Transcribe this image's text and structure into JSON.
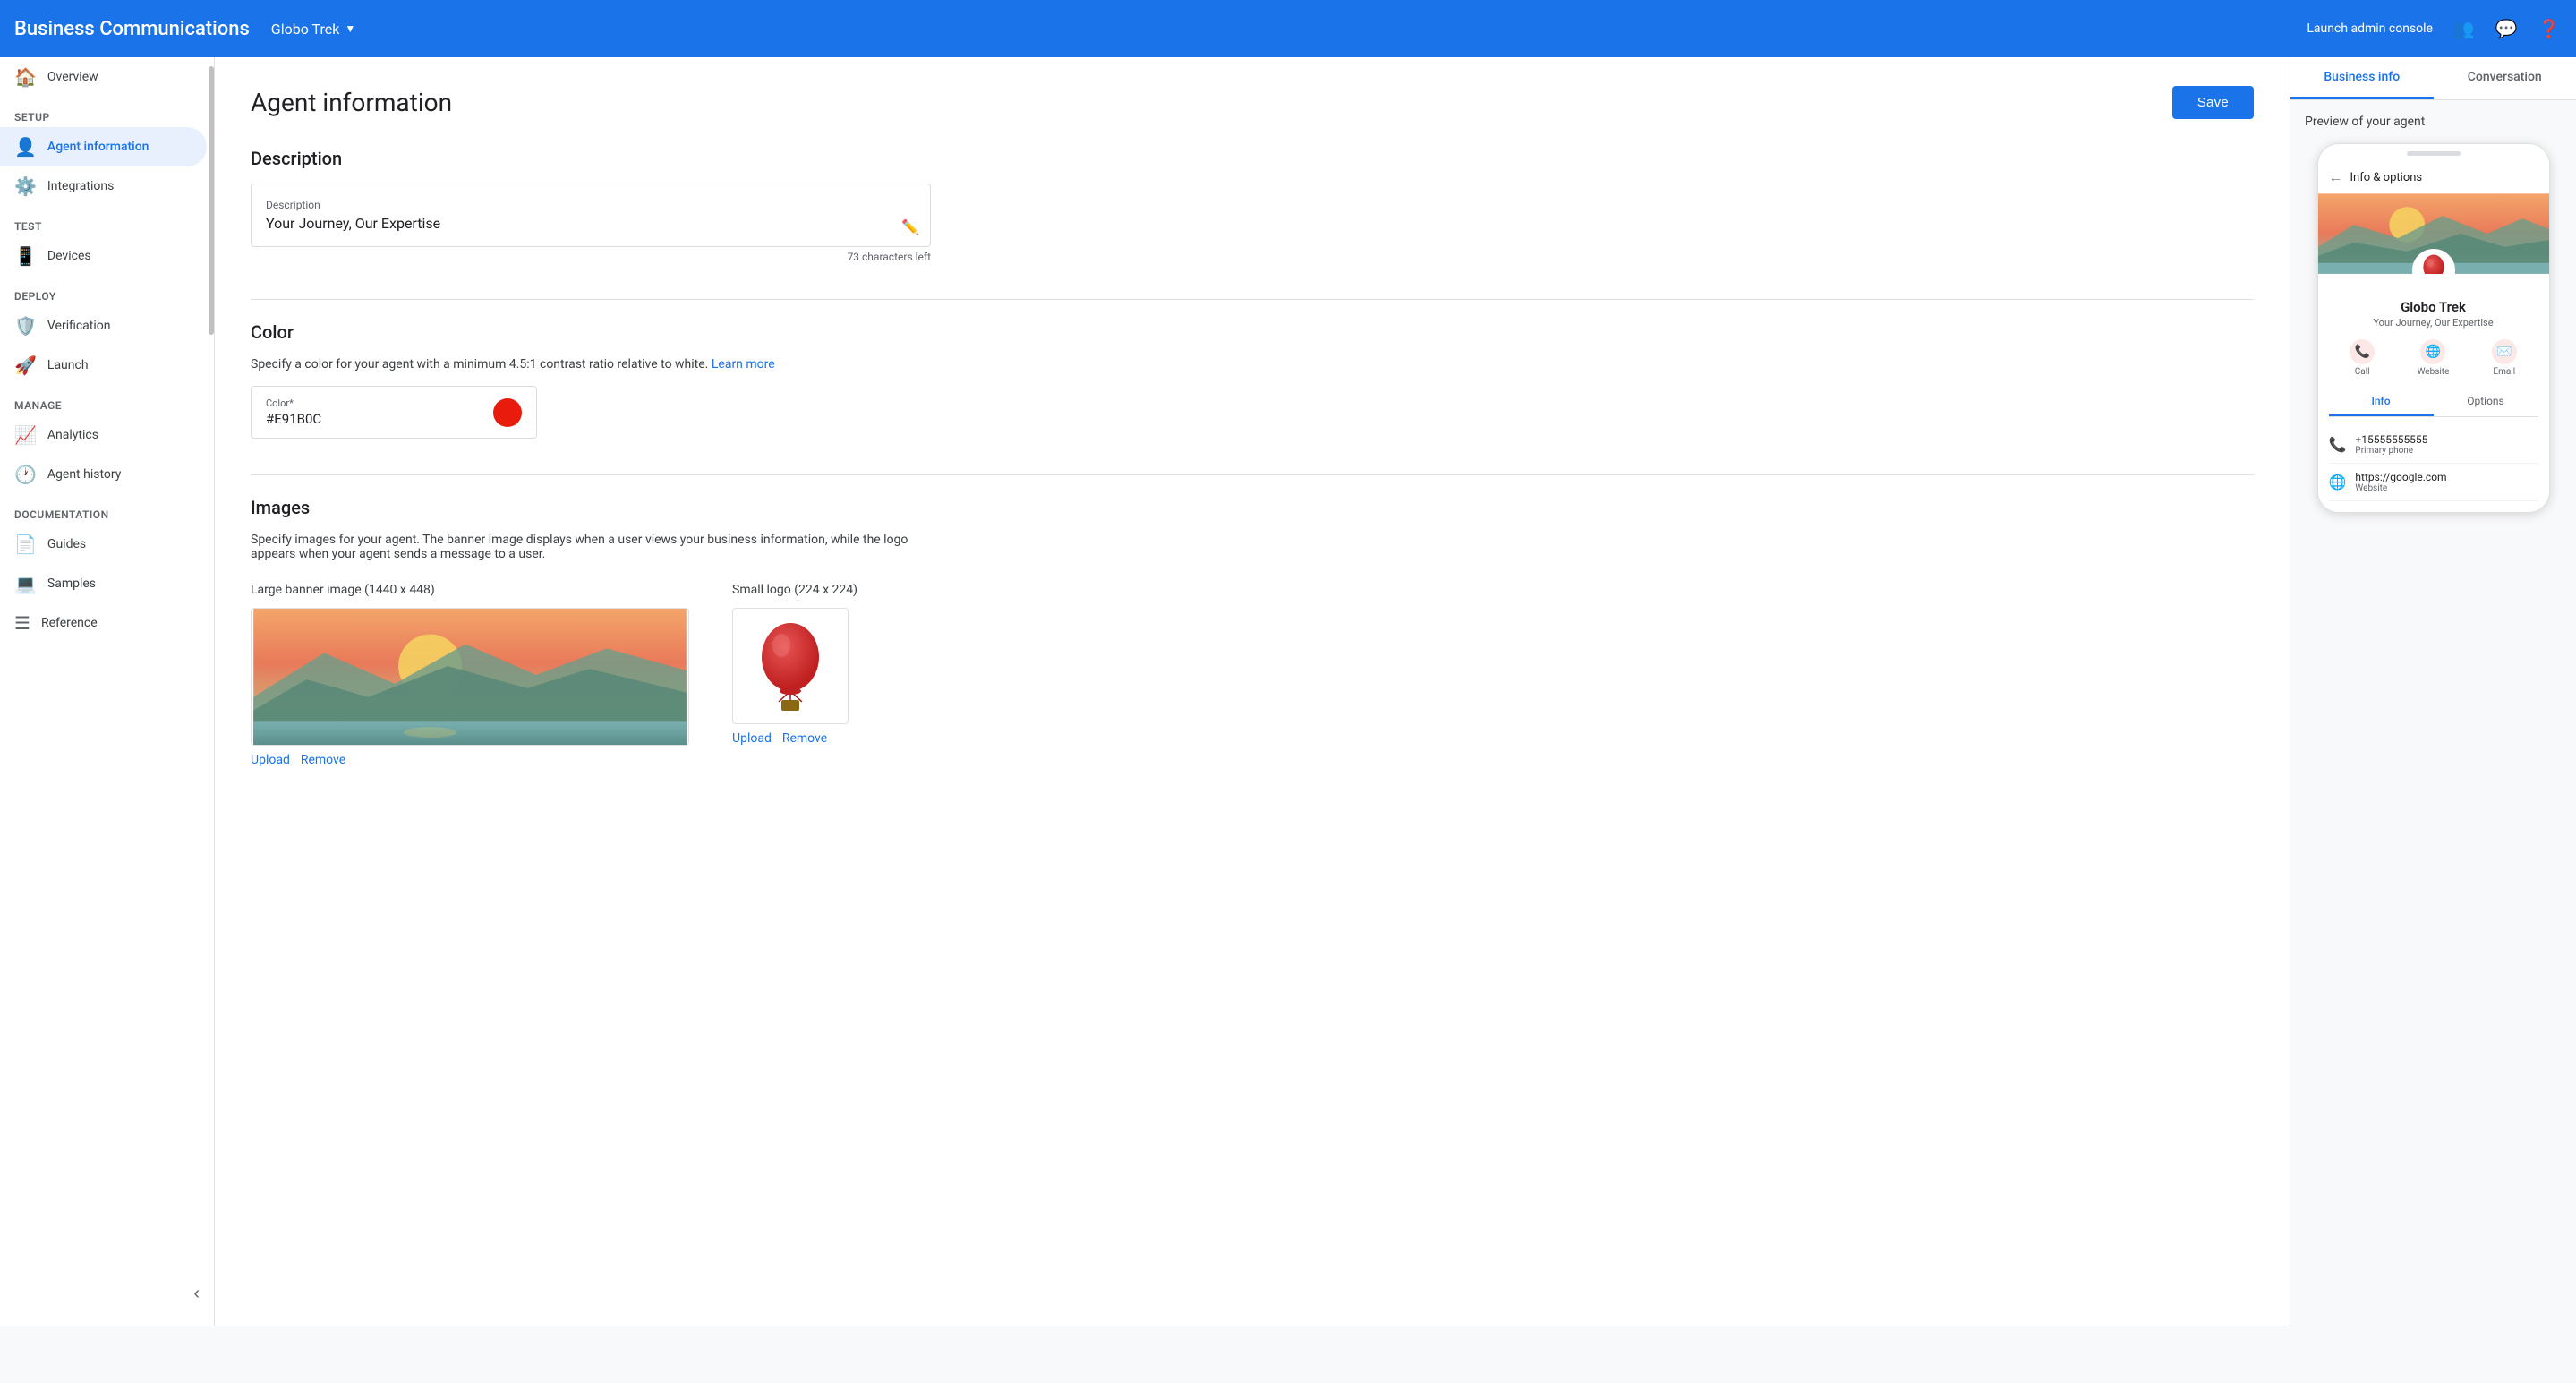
{
  "app": {
    "title": "Business Communications",
    "brand": "Globo Trek",
    "launch_admin_console": "Launch admin console"
  },
  "sidebar": {
    "sections": [
      {
        "label": "",
        "items": [
          {
            "id": "overview",
            "label": "Overview",
            "icon": "🏠",
            "active": false
          }
        ]
      },
      {
        "label": "Setup",
        "items": [
          {
            "id": "agent-information",
            "label": "Agent information",
            "icon": "👤",
            "active": true
          },
          {
            "id": "integrations",
            "label": "Integrations",
            "icon": "🔗",
            "active": false
          }
        ]
      },
      {
        "label": "Test",
        "items": [
          {
            "id": "devices",
            "label": "Devices",
            "icon": "📱",
            "active": false
          }
        ]
      },
      {
        "label": "Deploy",
        "items": [
          {
            "id": "verification",
            "label": "Verification",
            "icon": "🛡️",
            "active": false
          },
          {
            "id": "launch",
            "label": "Launch",
            "icon": "🚀",
            "active": false
          }
        ]
      },
      {
        "label": "Manage",
        "items": [
          {
            "id": "analytics",
            "label": "Analytics",
            "icon": "📈",
            "active": false
          },
          {
            "id": "agent-history",
            "label": "Agent history",
            "icon": "🕐",
            "active": false
          }
        ]
      },
      {
        "label": "Documentation",
        "items": [
          {
            "id": "guides",
            "label": "Guides",
            "icon": "📄",
            "active": false
          },
          {
            "id": "samples",
            "label": "Samples",
            "icon": "💻",
            "active": false
          },
          {
            "id": "reference",
            "label": "Reference",
            "icon": "☰",
            "active": false
          }
        ]
      }
    ]
  },
  "main": {
    "page_title": "Agent information",
    "save_button": "Save",
    "sections": {
      "description": {
        "title": "Description",
        "field_label": "Description",
        "field_value": "Your Journey, Our Expertise",
        "char_count": "73 characters left"
      },
      "color": {
        "title": "Color",
        "description": "Specify a color for your agent with a minimum 4.5:1 contrast ratio relative to white.",
        "learn_more": "Learn more",
        "field_label": "Color*",
        "field_value": "#E91B0C",
        "color_hex": "#E91B0C"
      },
      "images": {
        "title": "Images",
        "description": "Specify images for your agent. The banner image displays when a user views your business information, while the logo appears when your agent sends a message to a user.",
        "banner_label": "Large banner image (1440 x 448)",
        "logo_label": "Small logo (224 x 224)",
        "upload_label": "Upload",
        "remove_label": "Remove"
      }
    }
  },
  "preview": {
    "tabs": [
      {
        "id": "business-info",
        "label": "Business info",
        "active": true
      },
      {
        "id": "conversation",
        "label": "Conversation",
        "active": false
      }
    ],
    "label": "Preview of your agent",
    "phone": {
      "header": "Info & options",
      "agent_name": "Globo Trek",
      "agent_desc": "Your Journey, Our Expertise",
      "actions": [
        {
          "id": "call",
          "label": "Call",
          "icon": "📞",
          "color": "#e8453c"
        },
        {
          "id": "website",
          "label": "Website",
          "icon": "🌐",
          "color": "#e8453c"
        },
        {
          "id": "email",
          "label": "Email",
          "icon": "✉️",
          "color": "#e8453c"
        }
      ],
      "sub_tabs": [
        {
          "id": "info",
          "label": "Info",
          "active": true
        },
        {
          "id": "options",
          "label": "Options",
          "active": false
        }
      ],
      "info_rows": [
        {
          "icon": "📞",
          "main": "+15555555555",
          "sub": "Primary phone"
        },
        {
          "icon": "🌐",
          "main": "https://google.com",
          "sub": "Website"
        }
      ]
    }
  }
}
